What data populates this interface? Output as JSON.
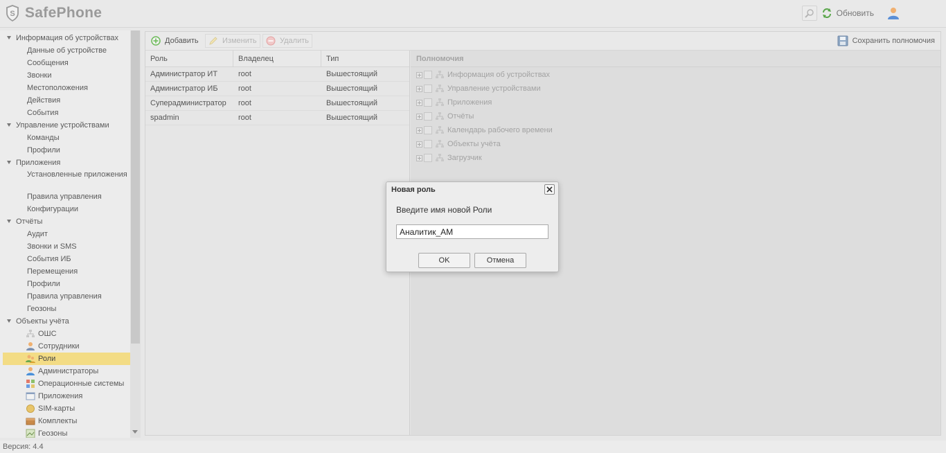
{
  "app": {
    "title": "SafePhone",
    "refresh_label": "Обновить",
    "version": "Версия: 4.4"
  },
  "sidebar": {
    "items": [
      {
        "label": "Информация об устройствах",
        "level": 0
      },
      {
        "label": "Данные об устройстве",
        "level": 1
      },
      {
        "label": "Сообщения",
        "level": 1
      },
      {
        "label": "Звонки",
        "level": 1
      },
      {
        "label": "Местоположения",
        "level": 1
      },
      {
        "label": "Действия",
        "level": 1
      },
      {
        "label": "События",
        "level": 1
      },
      {
        "label": "Управление устройствами",
        "level": 0
      },
      {
        "label": "Команды",
        "level": 1
      },
      {
        "label": "Профили",
        "level": 1
      },
      {
        "label": "Приложения",
        "level": 0
      },
      {
        "label": "Установленные приложения",
        "level": 1
      },
      {
        "label": "Правила управления",
        "level": 1
      },
      {
        "label": "Конфигурации",
        "level": 1
      },
      {
        "label": "Отчёты",
        "level": 0
      },
      {
        "label": "Аудит",
        "level": 1
      },
      {
        "label": "Звонки и SMS",
        "level": 1
      },
      {
        "label": "События ИБ",
        "level": 1
      },
      {
        "label": "Перемещения",
        "level": 1
      },
      {
        "label": "Профили",
        "level": 1
      },
      {
        "label": "Правила управления",
        "level": 1
      },
      {
        "label": "Геозоны",
        "level": 1
      },
      {
        "label": "Объекты учёта",
        "level": 0
      },
      {
        "label": "ОШС",
        "level": 1,
        "icon": "org-structure-icon"
      },
      {
        "label": "Сотрудники",
        "level": 1,
        "icon": "employee-icon"
      },
      {
        "label": "Роли",
        "level": 1,
        "icon": "roles-icon",
        "selected": true
      },
      {
        "label": "Администраторы",
        "level": 1,
        "icon": "admin-icon"
      },
      {
        "label": "Операционные системы",
        "level": 1,
        "icon": "os-icon"
      },
      {
        "label": "Приложения",
        "level": 1,
        "icon": "application-icon"
      },
      {
        "label": "SIM-карты",
        "level": 1,
        "icon": "sim-icon"
      },
      {
        "label": "Комплекты",
        "level": 1,
        "icon": "kit-icon"
      },
      {
        "label": "Геозоны",
        "level": 1,
        "icon": "geozone-icon"
      }
    ]
  },
  "toolbar": {
    "add_label": "Добавить",
    "edit_label": "Изменить",
    "delete_label": "Удалить",
    "save_label": "Сохранить полномочия"
  },
  "roles_table": {
    "columns": [
      "Роль",
      "Владелец",
      "Тип"
    ],
    "rows": [
      [
        "Администратор ИТ",
        "root",
        "Вышестоящий"
      ],
      [
        "Администратор ИБ",
        "root",
        "Вышестоящий"
      ],
      [
        "Суперадминистратор",
        "root",
        "Вышестоящий"
      ],
      [
        "spadmin",
        "root",
        "Вышестоящий"
      ]
    ]
  },
  "permissions": {
    "header": "Полномочия",
    "items": [
      "Информация об устройствах",
      "Управление устройствами",
      "Приложения",
      "Отчёты",
      "Календарь рабочего времени",
      "Объекты учёта",
      "Загрузчик"
    ]
  },
  "dialog": {
    "title": "Новая роль",
    "message": "Введите имя новой Роли",
    "input_value": "Аналитик_АМ",
    "ok_label": "OK",
    "cancel_label": "Отмена"
  },
  "colors": {
    "selection": "#f3dc85",
    "add_icon": "#6dbb5a",
    "delete_icon": "#e07070",
    "refresh_icon": "#5aa64a"
  }
}
